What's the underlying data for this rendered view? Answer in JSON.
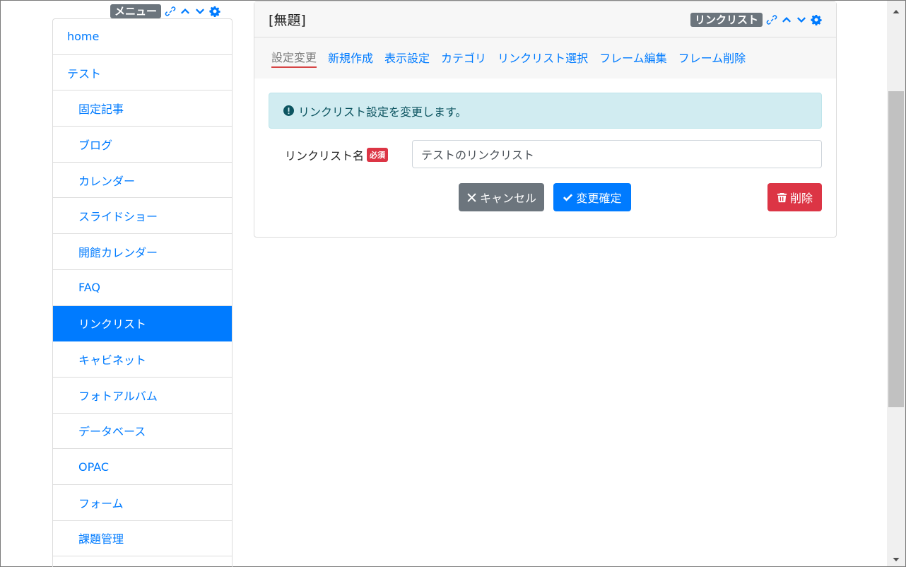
{
  "menu_frame": {
    "badge": "メニュー",
    "items": [
      {
        "label": "home",
        "level": 0,
        "active": false
      },
      {
        "label": "テスト",
        "level": 0,
        "active": false
      },
      {
        "label": "固定記事",
        "level": 1,
        "active": false
      },
      {
        "label": "ブログ",
        "level": 1,
        "active": false
      },
      {
        "label": "カレンダー",
        "level": 1,
        "active": false
      },
      {
        "label": "スライドショー",
        "level": 1,
        "active": false
      },
      {
        "label": "開館カレンダー",
        "level": 1,
        "active": false
      },
      {
        "label": "FAQ",
        "level": 1,
        "active": false
      },
      {
        "label": "リンクリスト",
        "level": 1,
        "active": true
      },
      {
        "label": "キャビネット",
        "level": 1,
        "active": false
      },
      {
        "label": "フォトアルバム",
        "level": 1,
        "active": false
      },
      {
        "label": "データベース",
        "level": 1,
        "active": false
      },
      {
        "label": "OPAC",
        "level": 1,
        "active": false
      },
      {
        "label": "フォーム",
        "level": 1,
        "active": false
      },
      {
        "label": "課題管理",
        "level": 1,
        "active": false
      }
    ]
  },
  "frame": {
    "title": "[無題]",
    "badge": "リンクリスト",
    "tabs": [
      {
        "label": "設定変更",
        "active": true
      },
      {
        "label": "新規作成",
        "active": false
      },
      {
        "label": "表示設定",
        "active": false
      },
      {
        "label": "カテゴリ",
        "active": false
      },
      {
        "label": "リンクリスト選択",
        "active": false
      },
      {
        "label": "フレーム編集",
        "active": false
      },
      {
        "label": "フレーム削除",
        "active": false
      }
    ],
    "alert": "リンクリスト設定を変更します。",
    "form": {
      "name_label": "リンクリスト名",
      "required_badge": "必須",
      "name_value": "テストのリンクリスト"
    },
    "buttons": {
      "cancel": "キャンセル",
      "confirm": "変更確定",
      "delete": "削除"
    }
  },
  "colors": {
    "primary": "#007bff",
    "secondary": "#6c757d",
    "danger": "#dc3545",
    "info_bg": "#d1ecf1"
  }
}
